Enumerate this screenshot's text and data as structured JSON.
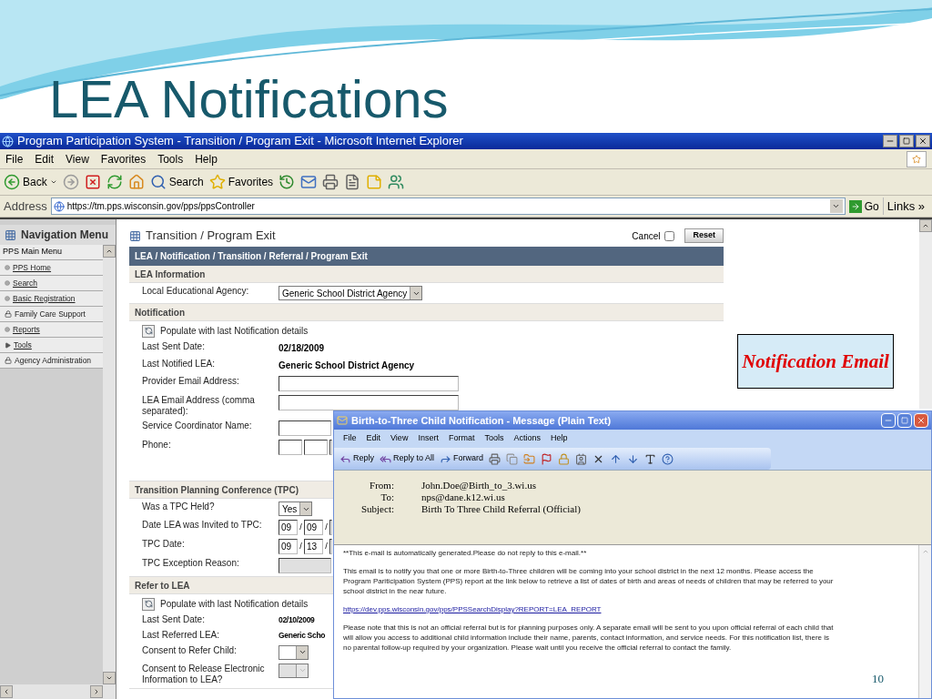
{
  "slide": {
    "title": "LEA Notifications",
    "callout": "Notification Email",
    "page_number": "10"
  },
  "browser": {
    "title": "Program Participation System - Transition / Program Exit - Microsoft Internet Explorer",
    "menu": [
      "File",
      "Edit",
      "View",
      "Favorites",
      "Tools",
      "Help"
    ],
    "toolbar": [
      {
        "kind": "back",
        "label": "Back"
      },
      {
        "kind": "forward"
      },
      {
        "kind": "stop"
      },
      {
        "kind": "refresh"
      },
      {
        "kind": "home"
      },
      {
        "kind": "search",
        "label": "Search"
      },
      {
        "kind": "favorites",
        "label": "Favorites"
      },
      {
        "kind": "history"
      },
      {
        "kind": "mail"
      },
      {
        "kind": "print"
      },
      {
        "kind": "edit"
      },
      {
        "kind": "note"
      },
      {
        "kind": "messenger"
      }
    ],
    "address": {
      "label": "Address",
      "url": "https://tm.pps.wisconsin.gov/pps/ppsController",
      "go": "Go",
      "links": "Links »"
    },
    "nav": {
      "title": "Navigation Menu",
      "main_menu": "PPS Main Menu",
      "items": [
        {
          "kind": "link",
          "label": "PPS Home"
        },
        {
          "kind": "link",
          "label": "Search"
        },
        {
          "kind": "link",
          "label": "Basic Registration"
        },
        {
          "kind": "locked",
          "label": "Family Care Support"
        },
        {
          "kind": "link",
          "label": "Reports"
        },
        {
          "kind": "folder",
          "label": "Tools"
        },
        {
          "kind": "locked",
          "label": "Agency Administration"
        }
      ]
    },
    "page": {
      "title": "Transition / Program Exit",
      "cancel": {
        "label": "Cancel",
        "checked": false
      },
      "reset": "Reset",
      "breadcrumb": "LEA / Notification / Transition / Referral / Program Exit",
      "sections": [
        {
          "title": "LEA Information",
          "rows": [
            {
              "kind": "select",
              "label": "Local Educational Agency:",
              "value": "Generic School District Agency",
              "disabled": false
            }
          ]
        },
        {
          "title": "Notification",
          "rows": [
            {
              "kind": "action",
              "label": "Populate with last Notification details"
            },
            {
              "kind": "text",
              "label": "Last Sent Date:",
              "value": "02/18/2009"
            },
            {
              "kind": "text",
              "label": "Last Notified LEA:",
              "value": "Generic School District Agency"
            },
            {
              "kind": "input",
              "label": "Provider Email Address:",
              "disabled": false
            },
            {
              "kind": "input",
              "label": "LEA Email Address (comma separated):",
              "disabled": false
            },
            {
              "kind": "input",
              "label": "Service Coordinator Name:",
              "disabled": false
            },
            {
              "kind": "phone",
              "label": "Phone:"
            }
          ]
        },
        {
          "title": "Transition Planning Conference (TPC)",
          "rows": [
            {
              "kind": "select",
              "label": "Was a TPC Held?",
              "value": "Yes",
              "disabled": false
            },
            {
              "kind": "date",
              "label": "Date LEA was Invited to TPC:",
              "parts": [
                "09",
                "09"
              ],
              "separator": "/"
            },
            {
              "kind": "date",
              "label": "TPC Date:",
              "parts": [
                "09",
                "13"
              ],
              "separator": "/"
            },
            {
              "kind": "input",
              "label": "TPC Exception Reason:",
              "disabled": true
            }
          ]
        },
        {
          "title": "Refer to LEA",
          "rows": [
            {
              "kind": "action",
              "label": "Populate with last Notification details"
            },
            {
              "kind": "text",
              "label": "Last Sent Date:",
              "value": "02/10/2009"
            },
            {
              "kind": "text",
              "label": "Last Referred LEA:",
              "value": "Generic Scho"
            },
            {
              "kind": "select",
              "label": "Consent to Refer Child:",
              "disabled": false
            },
            {
              "kind": "select",
              "label": "Consent to Release Electronic Information to LEA?",
              "disabled": true
            }
          ]
        }
      ]
    }
  },
  "email": {
    "title": "Birth-to-Three Child Notification - Message (Plain Text)",
    "menu": [
      "File",
      "Edit",
      "View",
      "Insert",
      "Format",
      "Tools",
      "Actions",
      "Help"
    ],
    "toolbar": [
      {
        "kind": "reply",
        "label": "Reply"
      },
      {
        "kind": "reply_all",
        "label": "Reply to All"
      },
      {
        "kind": "forward",
        "label": "Forward"
      },
      {
        "kind": "print"
      },
      {
        "kind": "copy"
      },
      {
        "kind": "move"
      },
      {
        "kind": "flag"
      },
      {
        "kind": "lock"
      },
      {
        "kind": "contacts"
      },
      {
        "kind": "delete"
      },
      {
        "kind": "previous"
      },
      {
        "kind": "next"
      },
      {
        "kind": "font"
      },
      {
        "kind": "help"
      }
    ],
    "headers": [
      {
        "label": "From:",
        "value": "John.Doe@Birth_to_3.wi.us"
      },
      {
        "label": "To:",
        "value": "nps@dane.k12.wi.us"
      },
      {
        "label": "Subject:",
        "value": "Birth To Three Child Referral (Official)"
      }
    ],
    "body": [
      {
        "kind": "text",
        "text": "**This e-mail is automatically generated.Please do not reply to this e-mail.**"
      },
      {
        "kind": "text",
        "text": "This email is to notify you that one or more Birth-to-Three children will be coming into your school district in the next 12 months. Please access the Program Pariticipation System (PPS) report at the link below to retrieve a list of dates of birth and areas of needs of children that may be referred to your school district in the near future."
      },
      {
        "kind": "link",
        "text": "https://dev.pps.wisconsin.gov/pps/PPSSearchDisplay?REPORT=LEA_REPORT"
      },
      {
        "kind": "text",
        "text": "Please note that this is not an official referral but is for planning purposes only. A separate email will be sent to you upon official referral of each child that will allow you access to additional child information include their name, parents, contact information, and service needs. For this notification list, there is no parental follow-up required by your organization. Please wait until you receive the official referral to contact the family."
      }
    ]
  }
}
